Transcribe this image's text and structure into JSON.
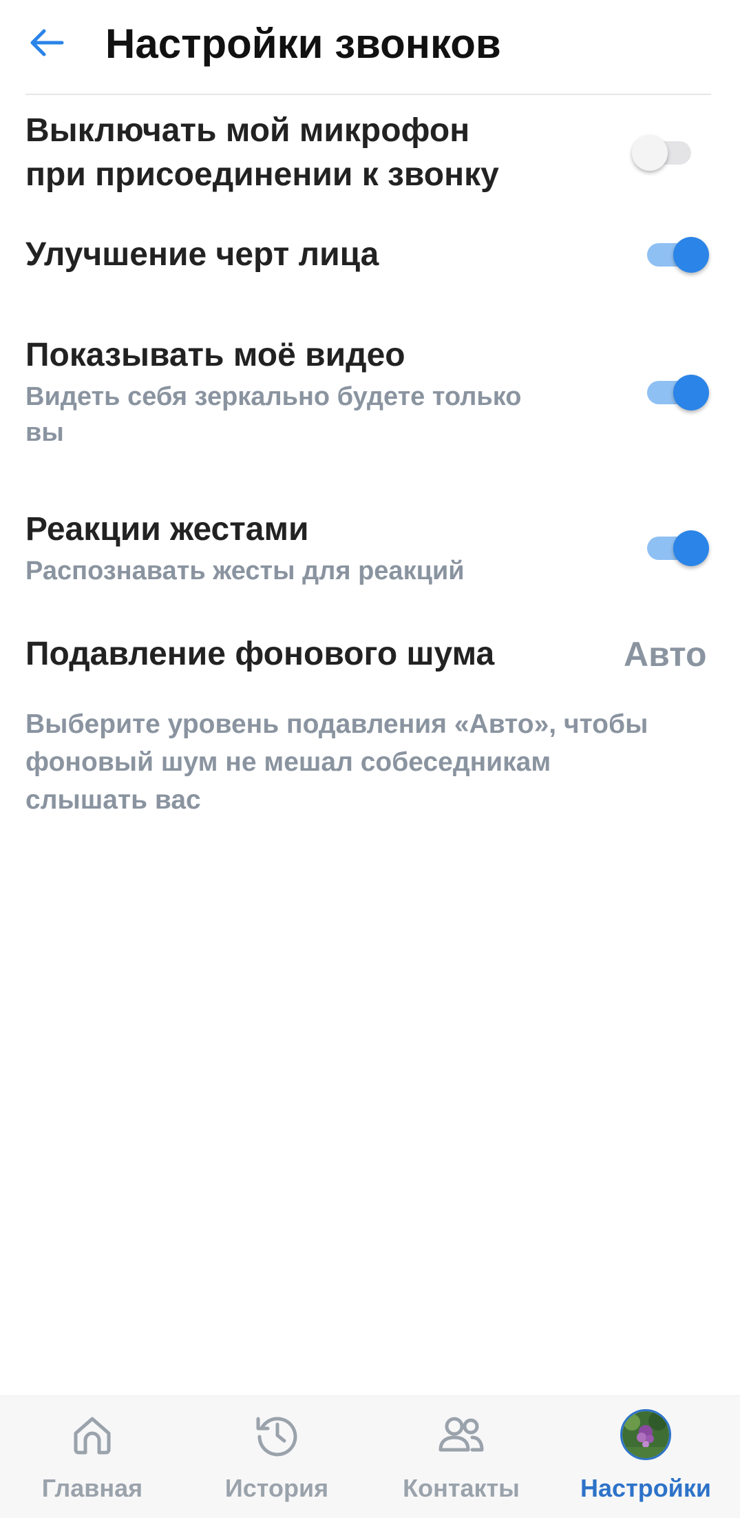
{
  "header": {
    "title": "Настройки звонков",
    "back_icon": "arrow-left-icon"
  },
  "settings": {
    "mute_on_join": {
      "title_line1": "Выключать мой микрофон",
      "title_line2": "при присоединении к звонку",
      "enabled": false
    },
    "face_enhance": {
      "title": "Улучшение черт лица",
      "enabled": true
    },
    "show_video": {
      "title": "Показывать моё видео",
      "subtitle_line1": "Видеть себя зеркально будете только",
      "subtitle_line2": "вы",
      "enabled": true
    },
    "gesture_reactions": {
      "title": "Реакции жестами",
      "subtitle": "Распознавать жесты для реакций",
      "enabled": true
    },
    "noise_suppression": {
      "title": "Подавление фонового шума",
      "value": "Авто",
      "description_line1": "Выберите уровень подавления «Авто», чтобы",
      "description_line2": "фоновый шум не мешал собеседникам",
      "description_line3": "слышать вас"
    }
  },
  "bottom_nav": {
    "items": [
      {
        "label": "Главная",
        "icon": "home-icon",
        "active": false
      },
      {
        "label": "История",
        "icon": "history-icon",
        "active": false
      },
      {
        "label": "Контакты",
        "icon": "contacts-icon",
        "active": false
      },
      {
        "label": "Настройки",
        "icon": "avatar",
        "active": true
      }
    ]
  },
  "colors": {
    "accent": "#2b84e8",
    "accent_light": "#8fc0f3",
    "nav_active": "#2d73c8",
    "secondary_text": "#8a94a0",
    "toggle_off_track": "#e4e4e6"
  }
}
